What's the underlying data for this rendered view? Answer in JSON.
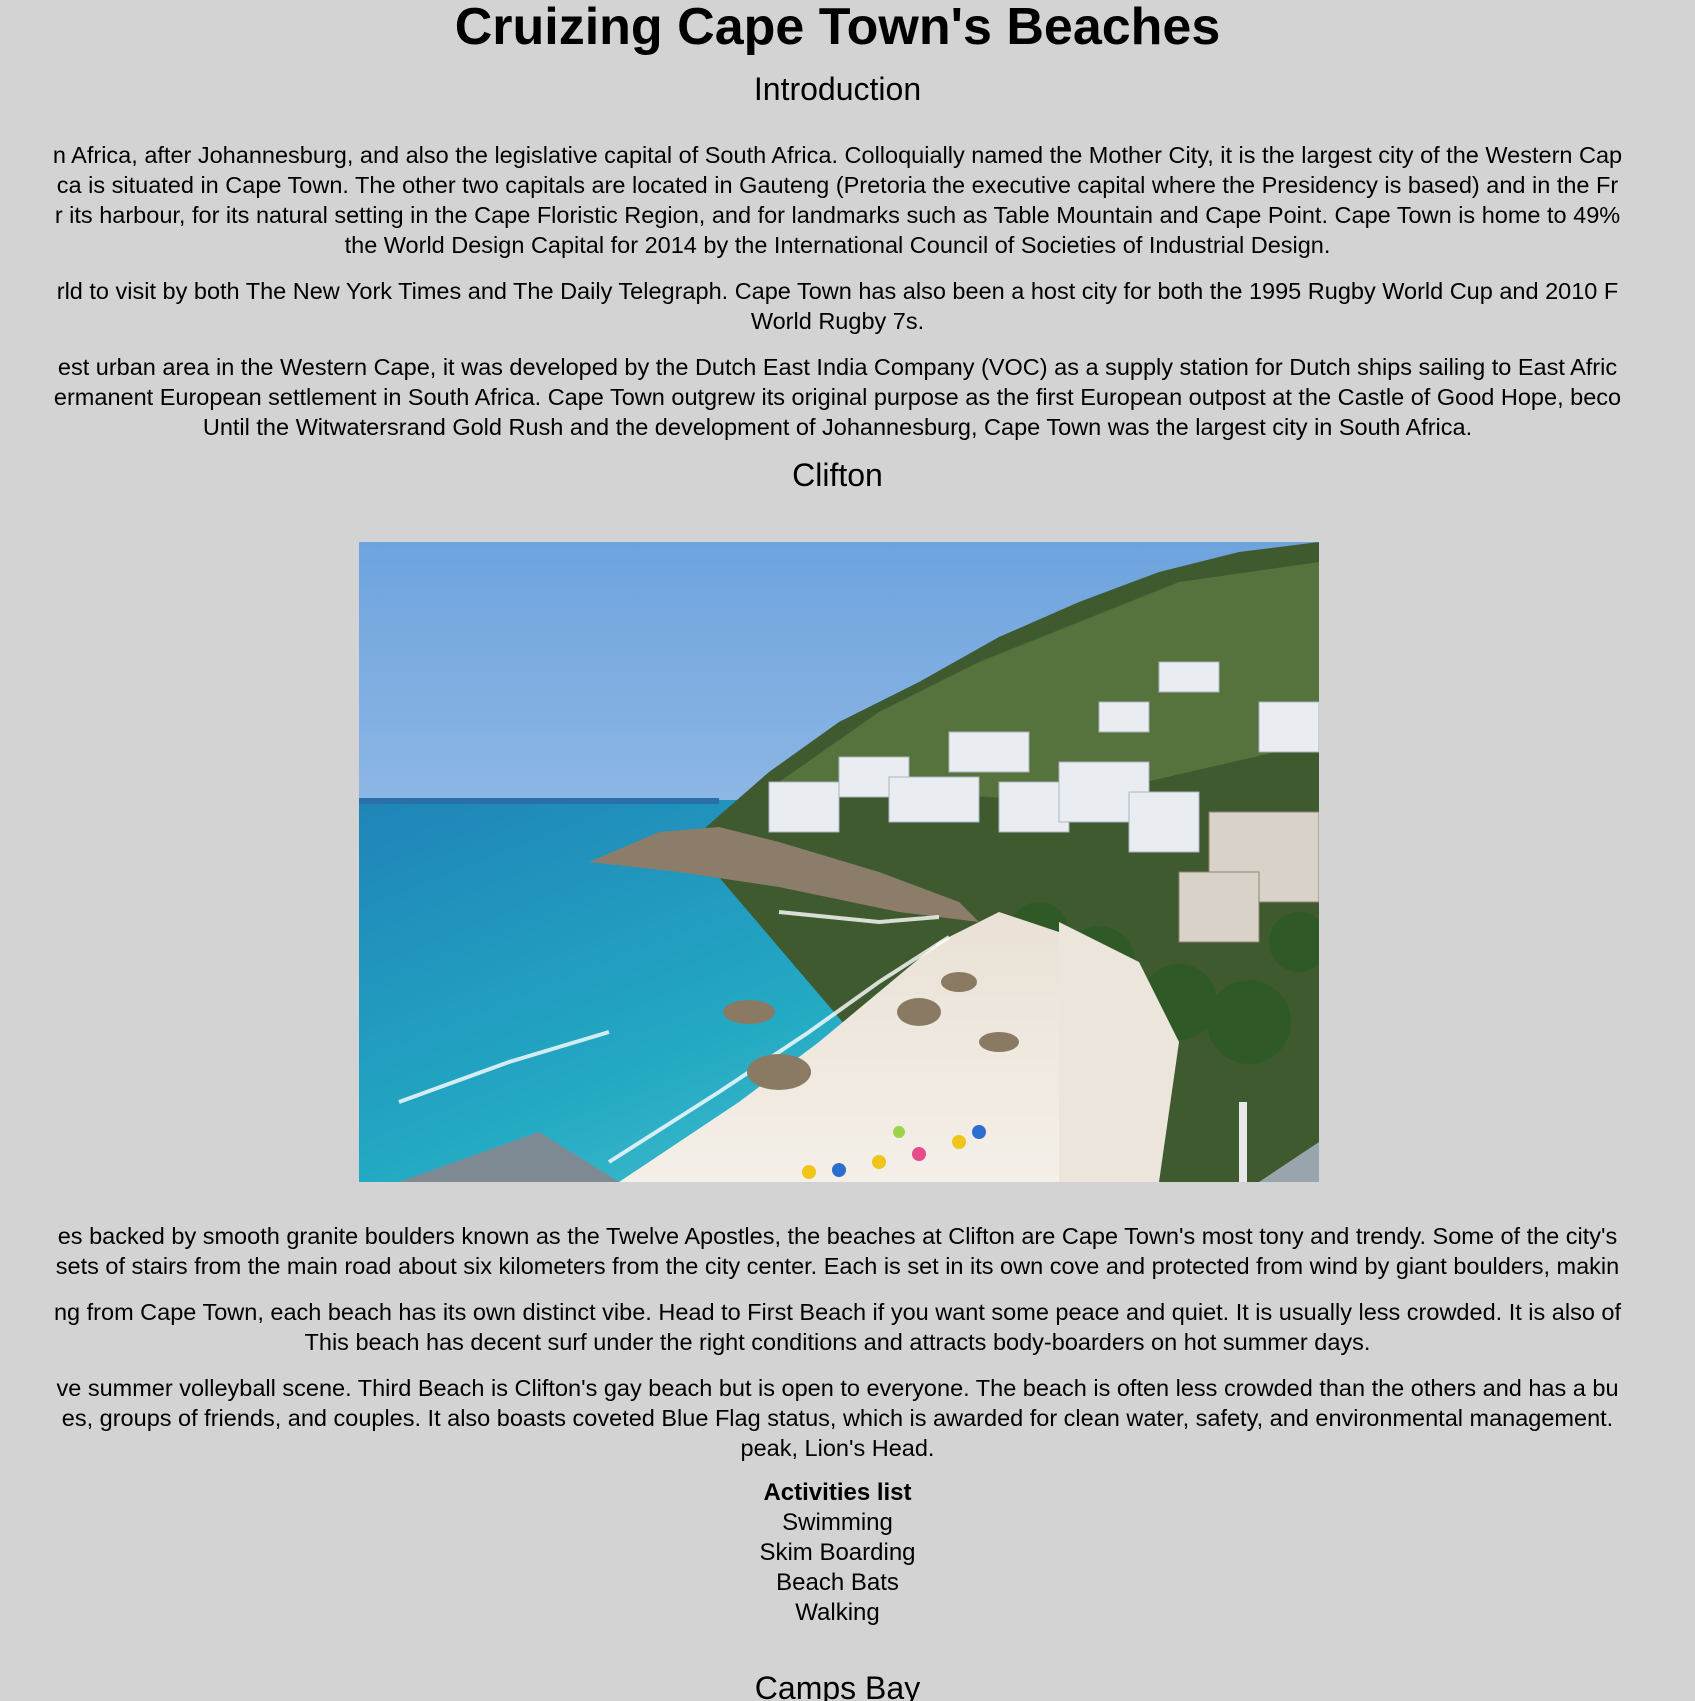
{
  "title": "Cruizing Cape Town's Beaches",
  "sections": {
    "intro": {
      "heading": "Introduction",
      "paragraph1": [
        "n Africa, after Johannesburg, and also the legislative capital of South Africa. Colloquially named the Mother City, it is the largest city of the Western Cap",
        "ca is situated in Cape Town. The other two capitals are located in Gauteng (Pretoria the executive capital where the Presidency is based) and in the Fr",
        "r its harbour, for its natural setting in the Cape Floristic Region, and for landmarks such as Table Mountain and Cape Point. Cape Town is home to 49%",
        "the World Design Capital for 2014 by the International Council of Societies of Industrial Design."
      ],
      "paragraph2": [
        "rld to visit by both The New York Times and The Daily Telegraph. Cape Town has also been a host city for both the 1995 Rugby World Cup and 2010 F",
        "World Rugby 7s."
      ],
      "paragraph3": [
        "est urban area in the Western Cape, it was developed by the Dutch East India Company (VOC) as a supply station for Dutch ships sailing to East Afric",
        "ermanent European settlement in South Africa. Cape Town outgrew its original purpose as the first European outpost at the Castle of Good Hope, beco",
        "Until the Witwatersrand Gold Rush and the development of Johannesburg, Cape Town was the largest city in South Africa."
      ]
    },
    "clifton": {
      "heading": "Clifton",
      "paragraph1": [
        "es backed by smooth granite boulders known as the Twelve Apostles, the beaches at Clifton are Cape Town's most tony and trendy. Some of the city's",
        "sets of stairs from the main road about six kilometers from the city center. Each is set in its own cove and protected from wind by giant boulders, makin"
      ],
      "paragraph2": [
        "ng from Cape Town, each beach has its own distinct vibe. Head to First Beach if you want some peace and quiet. It is usually less crowded. It is also of",
        "This beach has decent surf under the right conditions and attracts body-boarders on hot summer days."
      ],
      "paragraph3": [
        "ve summer volleyball scene. Third Beach is Clifton's gay beach but is open to everyone. The beach is often less crowded than the others and has a bu",
        "es, groups of friends, and couples. It also boasts coveted Blue Flag status, which is awarded for clean water, safety, and environmental management.",
        "peak, Lion's Head."
      ],
      "activities": {
        "title": "Activities list",
        "items": [
          "Swimming",
          "Skim Boarding",
          "Beach Bats",
          "Walking"
        ]
      }
    },
    "camps_bay": {
      "heading": "Camps Bay"
    }
  }
}
